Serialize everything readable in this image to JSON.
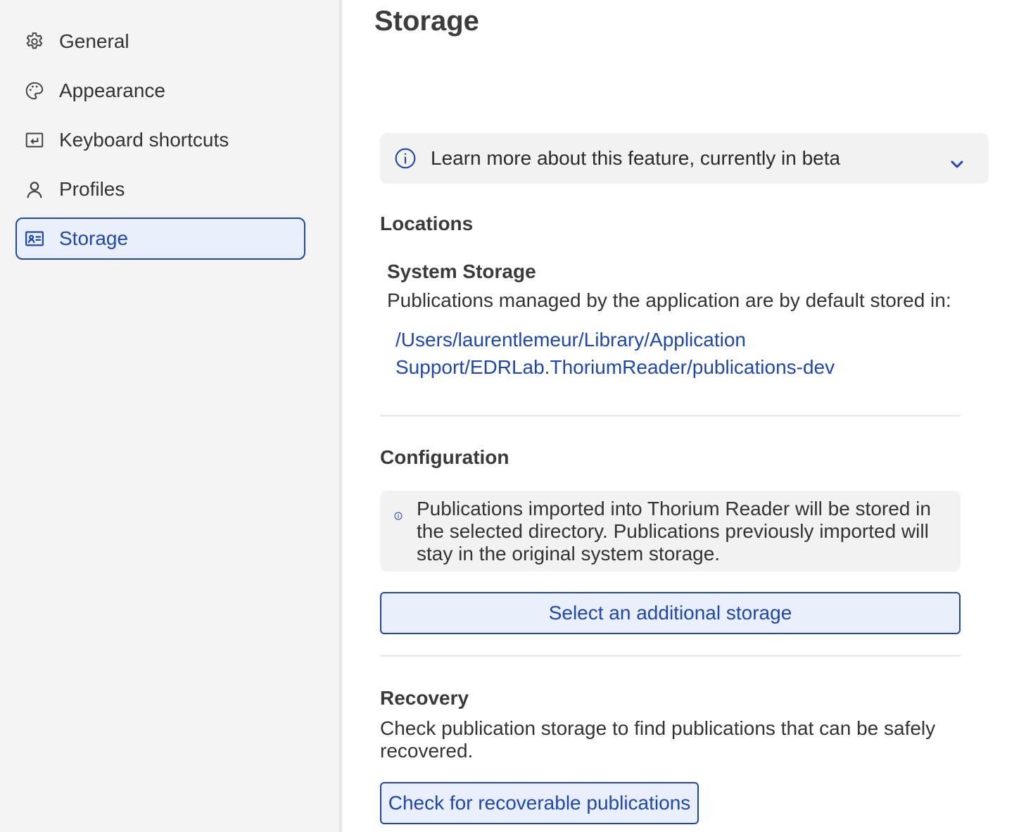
{
  "sidebar": {
    "items": [
      {
        "label": "General",
        "icon": "gear-icon"
      },
      {
        "label": "Appearance",
        "icon": "palette-icon"
      },
      {
        "label": "Keyboard shortcuts",
        "icon": "keyboard-icon"
      },
      {
        "label": "Profiles",
        "icon": "user-icon"
      },
      {
        "label": "Storage",
        "icon": "storage-card-icon",
        "active": true
      }
    ]
  },
  "main": {
    "title": "Storage",
    "beta_notice": "Learn more about this feature, currently in beta",
    "locations": {
      "heading": "Locations",
      "system_storage_heading": "System Storage",
      "description": "Publications managed by the application are by default stored in:",
      "path_line1": "/Users/laurentlemeur/Library/Application",
      "path_line2": "Support/EDRLab.ThoriumReader/publications-dev"
    },
    "configuration": {
      "heading": "Configuration",
      "notice": "Publications imported into Thorium Reader will be stored in the selected directory. Publications previously imported will stay in the original system storage.",
      "button_label": "Select an additional storage"
    },
    "recovery": {
      "heading": "Recovery",
      "description": "Check publication storage to find publications that can be safely recovered.",
      "button_label": "Check for recoverable publications"
    }
  },
  "colors": {
    "accent": "#1d46b8",
    "sidebar_bg": "#f4f4f4",
    "active_bg": "#eaf0fb",
    "notice_bg": "#f2f2f2"
  }
}
